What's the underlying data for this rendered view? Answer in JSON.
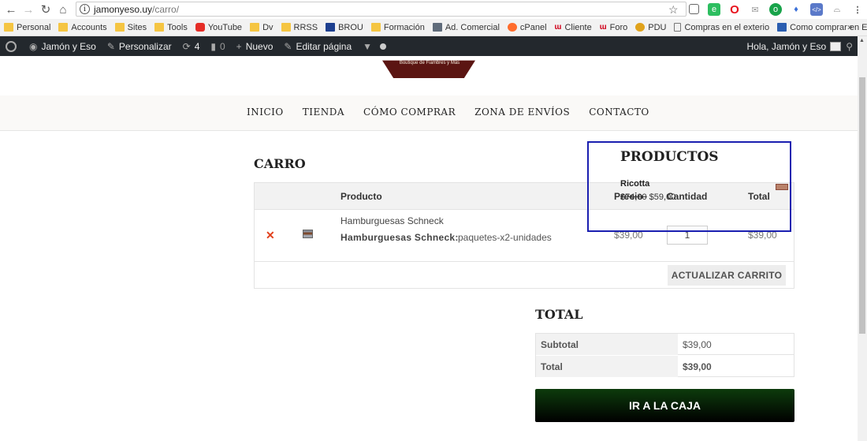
{
  "browser": {
    "url_domain": "jamonyeso.uy",
    "url_path": "/carro/",
    "bookmarks": [
      {
        "label": "Personal",
        "icon": "folder-icon"
      },
      {
        "label": "Accounts",
        "icon": "folder-icon"
      },
      {
        "label": "Sites",
        "icon": "folder-icon"
      },
      {
        "label": "Tools",
        "icon": "folder-icon"
      },
      {
        "label": "YouTube",
        "icon": "youtube-icon"
      },
      {
        "label": "Dv",
        "icon": "folder-icon"
      },
      {
        "label": "RRSS",
        "icon": "folder-icon"
      },
      {
        "label": "BROU",
        "icon": "brou-icon"
      },
      {
        "label": "Formación",
        "icon": "folder-icon"
      },
      {
        "label": "Ad. Comercial",
        "icon": "app-icon"
      },
      {
        "label": "cPanel",
        "icon": "cpanel-icon"
      },
      {
        "label": "Cliente",
        "icon": "w-icon"
      },
      {
        "label": "Foro",
        "icon": "w-icon"
      },
      {
        "label": "PDU",
        "icon": "pdu-icon"
      },
      {
        "label": "Compras en el exterio",
        "icon": "page-icon"
      },
      {
        "label": "Como comprar en Eb",
        "icon": "grid-icon"
      }
    ],
    "more": "»"
  },
  "wp_admin_bar": {
    "site_name": "Jamón y Eso",
    "customize": "Personalizar",
    "updates_count": "4",
    "comments_count": "0",
    "new_label": "Nuevo",
    "edit_page": "Editar página",
    "greeting": "Hola, Jamón y Eso"
  },
  "site": {
    "logo_tagline": "Boutique de Fiambres y Más",
    "nav": [
      "INICIO",
      "TIENDA",
      "CÓMO COMPRAR",
      "ZONA DE ENVÍOS",
      "CONTACTO"
    ]
  },
  "cart": {
    "title": "CARRO",
    "headers": {
      "product": "Producto",
      "price": "Precio",
      "quantity": "Cantidad",
      "total": "Total"
    },
    "item": {
      "name": "Hamburguesas Schneck",
      "variation_label": "Hamburguesas Schneck:",
      "variation_value": "paquetes-x2-unidades",
      "price": "$39,00",
      "quantity": "1",
      "total": "$39,00"
    },
    "update_button": "ACTUALIZAR CARRITO"
  },
  "totals": {
    "title": "TOTAL",
    "subtotal_label": "Subtotal",
    "subtotal_value": "$39,00",
    "total_label": "Total",
    "total_value": "$39,00",
    "checkout_button": "IR A LA CAJA"
  },
  "products_widget": {
    "title": "PRODUCTOS",
    "product_name": "Ricotta",
    "old_price": "$74,00",
    "new_price": "$59,00"
  },
  "colors": {
    "wp_bar": "#23282d",
    "remove": "#e2401c",
    "checkout_bg": "#0d3b0c",
    "widget_border": "#1a1fb0",
    "logo": "#5b1512"
  }
}
